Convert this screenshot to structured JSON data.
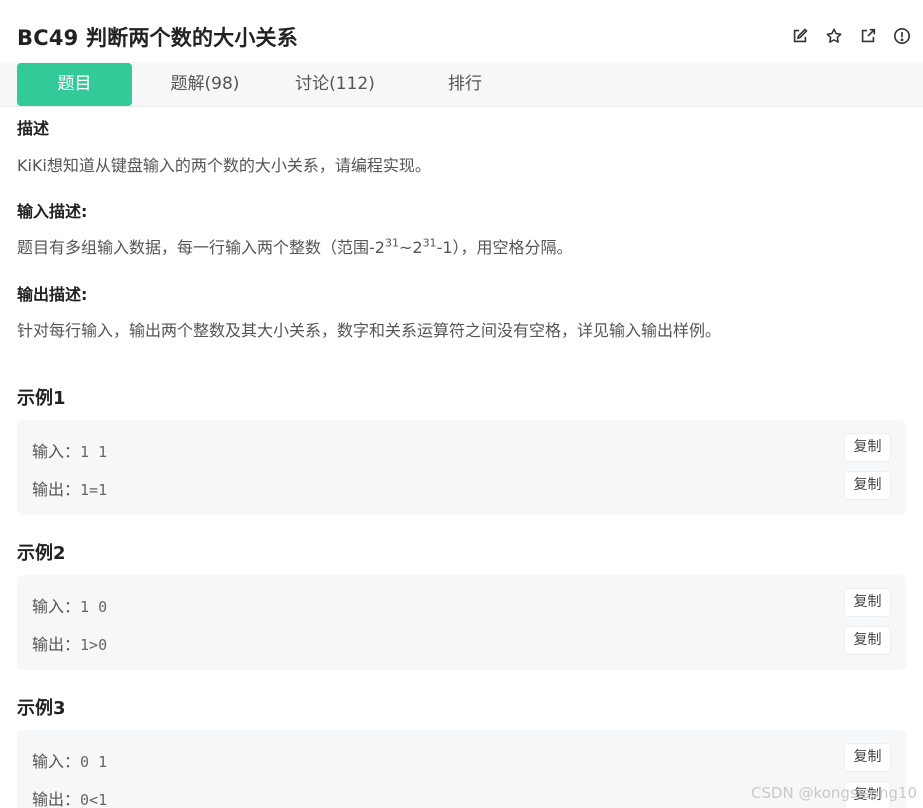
{
  "header": {
    "title": "BC49  判断两个数的大小关系",
    "actions": [
      "edit-icon",
      "star-icon",
      "external-link-icon",
      "info-icon"
    ]
  },
  "tabs": [
    {
      "label": "题目",
      "active": true
    },
    {
      "label": "题解(98)",
      "active": false
    },
    {
      "label": "讨论(112)",
      "active": false
    },
    {
      "label": "排行",
      "active": false
    }
  ],
  "description": {
    "title": "描述",
    "text": "KiKi想知道从键盘输入的两个数的大小关系，请编程实现。"
  },
  "input_desc": {
    "title": "输入描述:",
    "text_before": "题目有多组输入数据，每一行输入两个整数（范围-2",
    "exp1": "31",
    "text_mid": "~2",
    "exp2": "31",
    "text_after": "-1），用空格分隔。"
  },
  "output_desc": {
    "title": "输出描述:",
    "text": "针对每行输入，输出两个整数及其大小关系，数字和关系运算符之间没有空格，详见输入输出样例。"
  },
  "examples": [
    {
      "title": "示例1",
      "input_label": "输入：",
      "input": "1 1",
      "output_label": "输出：",
      "output": "1=1",
      "copy_label": "复制"
    },
    {
      "title": "示例2",
      "input_label": "输入：",
      "input": "1 0",
      "output_label": "输出：",
      "output": "1>0",
      "copy_label": "复制"
    },
    {
      "title": "示例3",
      "input_label": "输入：",
      "input": "0 1",
      "output_label": "输出：",
      "output": "0<1",
      "copy_label": "复制"
    }
  ],
  "colors": {
    "accent": "#32ca99",
    "panel": "#f6f7f8"
  },
  "watermark": "CSDN @kongsisong10"
}
